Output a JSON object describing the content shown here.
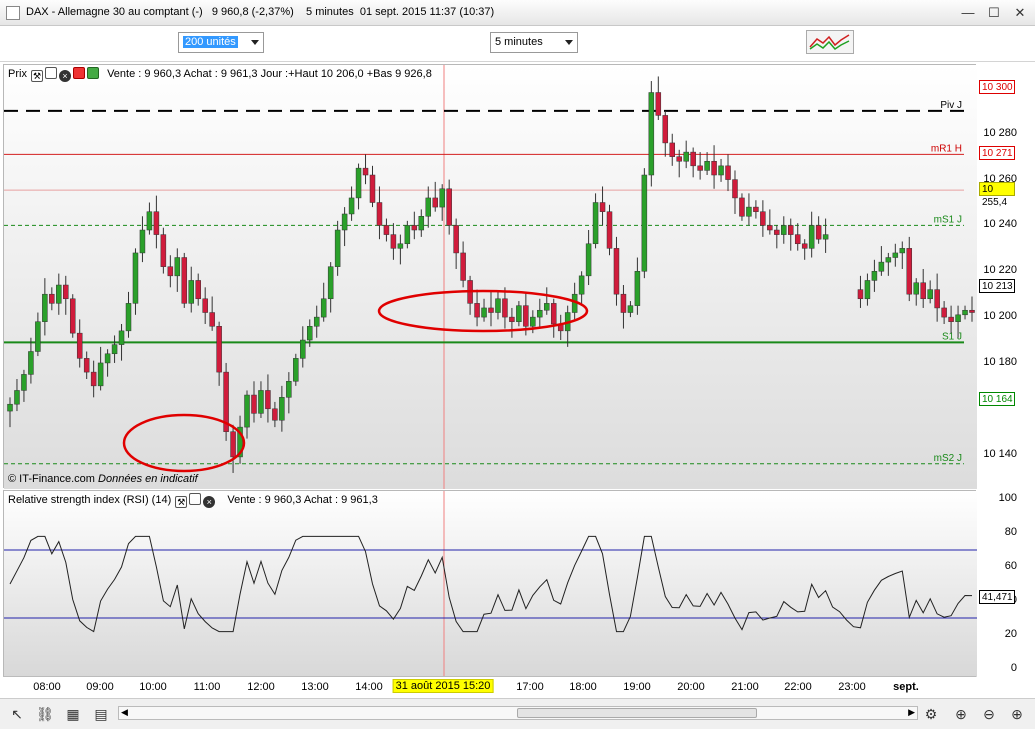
{
  "window": {
    "title": "DAX - Allemagne 30 au comptant (-)   9 960,8 (-2,37%)    5 minutes  01 sept. 2015 11:37 (10:37)",
    "min_icon": "minimize-icon",
    "max_icon": "maximize-icon",
    "close_icon": "close-icon"
  },
  "toolbar": {
    "interval_value": "200 unités",
    "timeframe_value": "5 minutes",
    "chart_type_icon": "chart-type-icon"
  },
  "price_panel": {
    "label": "Prix",
    "info": "Vente : 9 960,3 Achat : 9 961,3 Jour :+Haut 10 206,0 +Bas 9 926,8",
    "copyright": "© IT-Finance.com",
    "disclaimer": "Données en indicatif",
    "levels": {
      "piv": "Piv J",
      "mr1": "mR1 H",
      "ms1": "mS1 J",
      "s1": "S1 J",
      "ms2": "mS2 J"
    },
    "colors": {
      "up": "#2aa02a",
      "down": "#d01c3c",
      "s1_line": "#1a8a1a",
      "mr1_line": "#d42020",
      "circle": "#e00000",
      "cursor": "#f08080"
    }
  },
  "rsi_panel": {
    "label": "Relative strength index (RSI) (14)",
    "info": "Vente : 9 960,3 Achat : 9 961,3",
    "value": "41,471",
    "line_color": "#2222aa",
    "y_ticks": [
      "100",
      "80",
      "60",
      "40",
      "20",
      "0"
    ]
  },
  "price_axis": {
    "ticks": [
      "10 280",
      "10 260",
      "10 240",
      "10 220",
      "10 200",
      "10 180",
      "10 140"
    ],
    "badges": [
      {
        "text": "10 300",
        "kind": "red"
      },
      {
        "text": "10 271",
        "kind": "red"
      },
      {
        "text": "10 255,4",
        "kind": "yellow"
      },
      {
        "text": "10 213",
        "kind": "black"
      },
      {
        "text": "10 164",
        "kind": "green"
      }
    ]
  },
  "time_axis": {
    "ticks": [
      "08:00",
      "09:00",
      "10:00",
      "11:00",
      "12:00",
      "13:00",
      "14:00",
      "17:00",
      "18:00",
      "19:00",
      "20:00",
      "21:00",
      "22:00",
      "23:00",
      "sept."
    ],
    "cursor_label": "31 août 2015 15:20"
  },
  "chart_data": {
    "type": "candlestick",
    "instrument": "DAX - Allemagne 30 au comptant",
    "timeframe": "5 minutes",
    "y_range": [
      10125,
      10310
    ],
    "levels": {
      "piv": 10290,
      "mr1": 10271,
      "ms1": 10240,
      "s1": 10189,
      "ms2": 10136
    },
    "closes": [
      10162,
      10168,
      10175,
      10185,
      10198,
      10210,
      10206,
      10214,
      10208,
      10193,
      10182,
      10176,
      10170,
      10180,
      10184,
      10188,
      10194,
      10206,
      10228,
      10238,
      10246,
      10236,
      10222,
      10218,
      10226,
      10206,
      10216,
      10208,
      10202,
      10196,
      10176,
      10150,
      10139,
      10152,
      10166,
      10158,
      10168,
      10160,
      10155,
      10165,
      10172,
      10182,
      10190,
      10196,
      10200,
      10208,
      10222,
      10238,
      10245,
      10252,
      10265,
      10262,
      10250,
      10240,
      10236,
      10230,
      10232,
      10240,
      10238,
      10244,
      10252,
      10248,
      10256,
      10240,
      10228,
      10216,
      10206,
      10200,
      10204,
      10202,
      10208,
      10200,
      10198,
      10205,
      10196,
      10200,
      10203,
      10206,
      10197,
      10194,
      10202,
      10210,
      10218,
      10232,
      10250,
      10246,
      10230,
      10210,
      10202,
      10205,
      10220,
      10262,
      10298,
      10288,
      10276,
      10270,
      10268,
      10272,
      10266,
      10264,
      10268,
      10262,
      10266,
      10260,
      10252,
      10244,
      10248,
      10246,
      10240,
      10238,
      10236,
      10240,
      10236,
      10232,
      10230,
      10240,
      10234,
      10236,
      10228,
      10224,
      10218,
      10212,
      10208,
      10216,
      10220,
      10224,
      10226,
      10228,
      10230,
      10210,
      10215,
      10208,
      10212,
      10204,
      10200,
      10198,
      10201,
      10203,
      10202
    ],
    "rsi_y_range": [
      0,
      100
    ],
    "rsi_last": 41.471
  }
}
